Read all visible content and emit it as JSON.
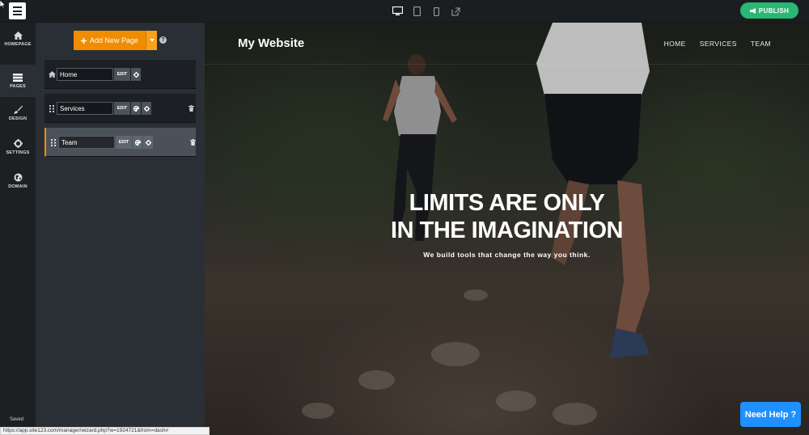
{
  "toolbar": {
    "devices": [
      "desktop-icon",
      "tablet-icon",
      "mobile-icon",
      "external-link-icon"
    ],
    "publish_label": "PUBLISH",
    "publish_color": "#2ab673"
  },
  "rail": {
    "items": [
      {
        "label": "HOMEPAGE",
        "icon": "home-icon"
      },
      {
        "label": "PAGES",
        "icon": "pages-icon"
      },
      {
        "label": "DESIGN",
        "icon": "brush-icon"
      },
      {
        "label": "SETTINGS",
        "icon": "gear-icon"
      },
      {
        "label": "DOMAIN",
        "icon": "globe-icon"
      }
    ],
    "active": "PAGES",
    "saved_label": "Saved"
  },
  "pages_panel": {
    "add_label": "Add New Page",
    "accent_color": "#f08c00",
    "pages": [
      {
        "name": "Home",
        "edit_label": "EDIT"
      },
      {
        "name": "Services",
        "edit_label": "EDIT"
      },
      {
        "name": "Team",
        "edit_label": "EDIT",
        "selected": true
      }
    ]
  },
  "preview": {
    "site_title": "My Website",
    "nav": [
      "HOME",
      "SERVICES",
      "TEAM"
    ],
    "hero_line1": "LIMITS ARE ONLY",
    "hero_line2": "IN THE IMAGINATION",
    "hero_sub": "We build tools that change the way you think."
  },
  "help_button_label": "Need Help ?",
  "status_url": "https://app.site123.com/manager/wizard.php?w=1924721&from=dash#"
}
